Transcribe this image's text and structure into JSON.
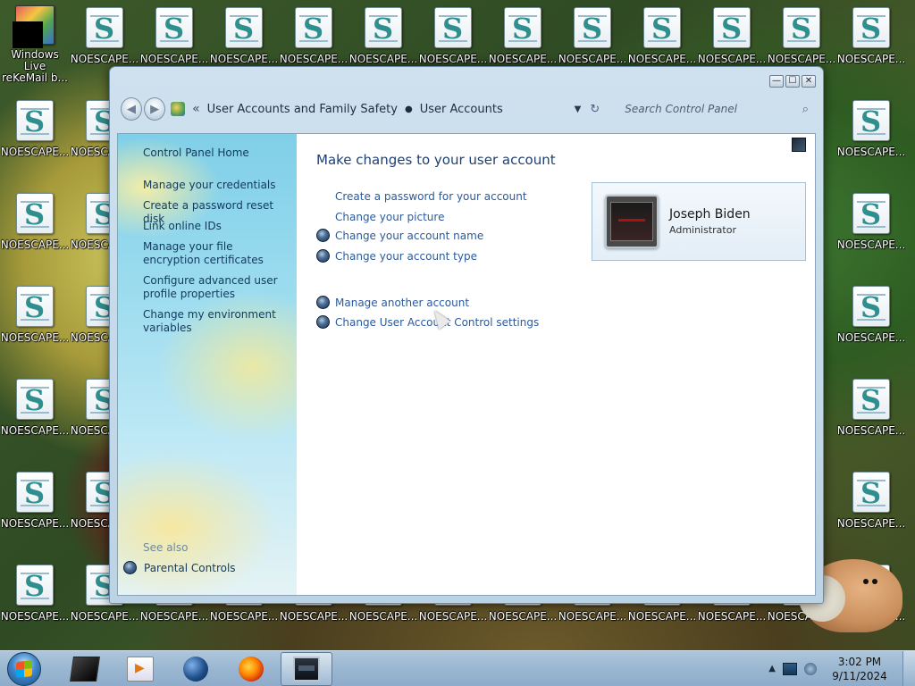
{
  "desktop": {
    "live_icon_label": "Windows Live reKeMail b...",
    "icon_label": "NOESCAPE...",
    "icon_kind": "script-icon"
  },
  "window": {
    "controls": {
      "minimize": "—",
      "maximize": "☐",
      "close": "✕"
    },
    "address": {
      "back_glyph": "◀",
      "forward_glyph": "▶",
      "chevron": "«",
      "crumb1": "User Accounts and Family Safety",
      "crumb_sep": "●",
      "crumb2": "User Accounts",
      "dropdown_glyph": "▼",
      "refresh_glyph": "↻"
    },
    "search": {
      "placeholder": "Search Control Panel",
      "icon_glyph": "⌕"
    },
    "left_pane": {
      "home": "Control Panel Home",
      "links": [
        "Manage your credentials",
        "Create a password reset disk",
        "Link online IDs",
        "Manage your file encryption certificates",
        "Configure advanced user profile properties",
        "Change my environment variables"
      ],
      "see_also": "See also",
      "parental_controls": "Parental Controls"
    },
    "main": {
      "heading": "Make changes to your user account",
      "tasks": [
        "Create a password for your account",
        "Change your picture",
        "Change your account name",
        "Change your account type"
      ],
      "more_tasks": [
        "Manage another account",
        "Change User Account Control settings"
      ]
    },
    "user_card": {
      "name": "Joseph Biden",
      "role": "Administrator"
    }
  },
  "taskbar": {
    "apps": [
      "box-app-icon",
      "media-player-icon",
      "globe-icon",
      "firefox-icon",
      "control-panel-icon"
    ],
    "tray_arrow": "▲",
    "clock": {
      "time": "3:02 PM",
      "date": "9/11/2024"
    }
  }
}
